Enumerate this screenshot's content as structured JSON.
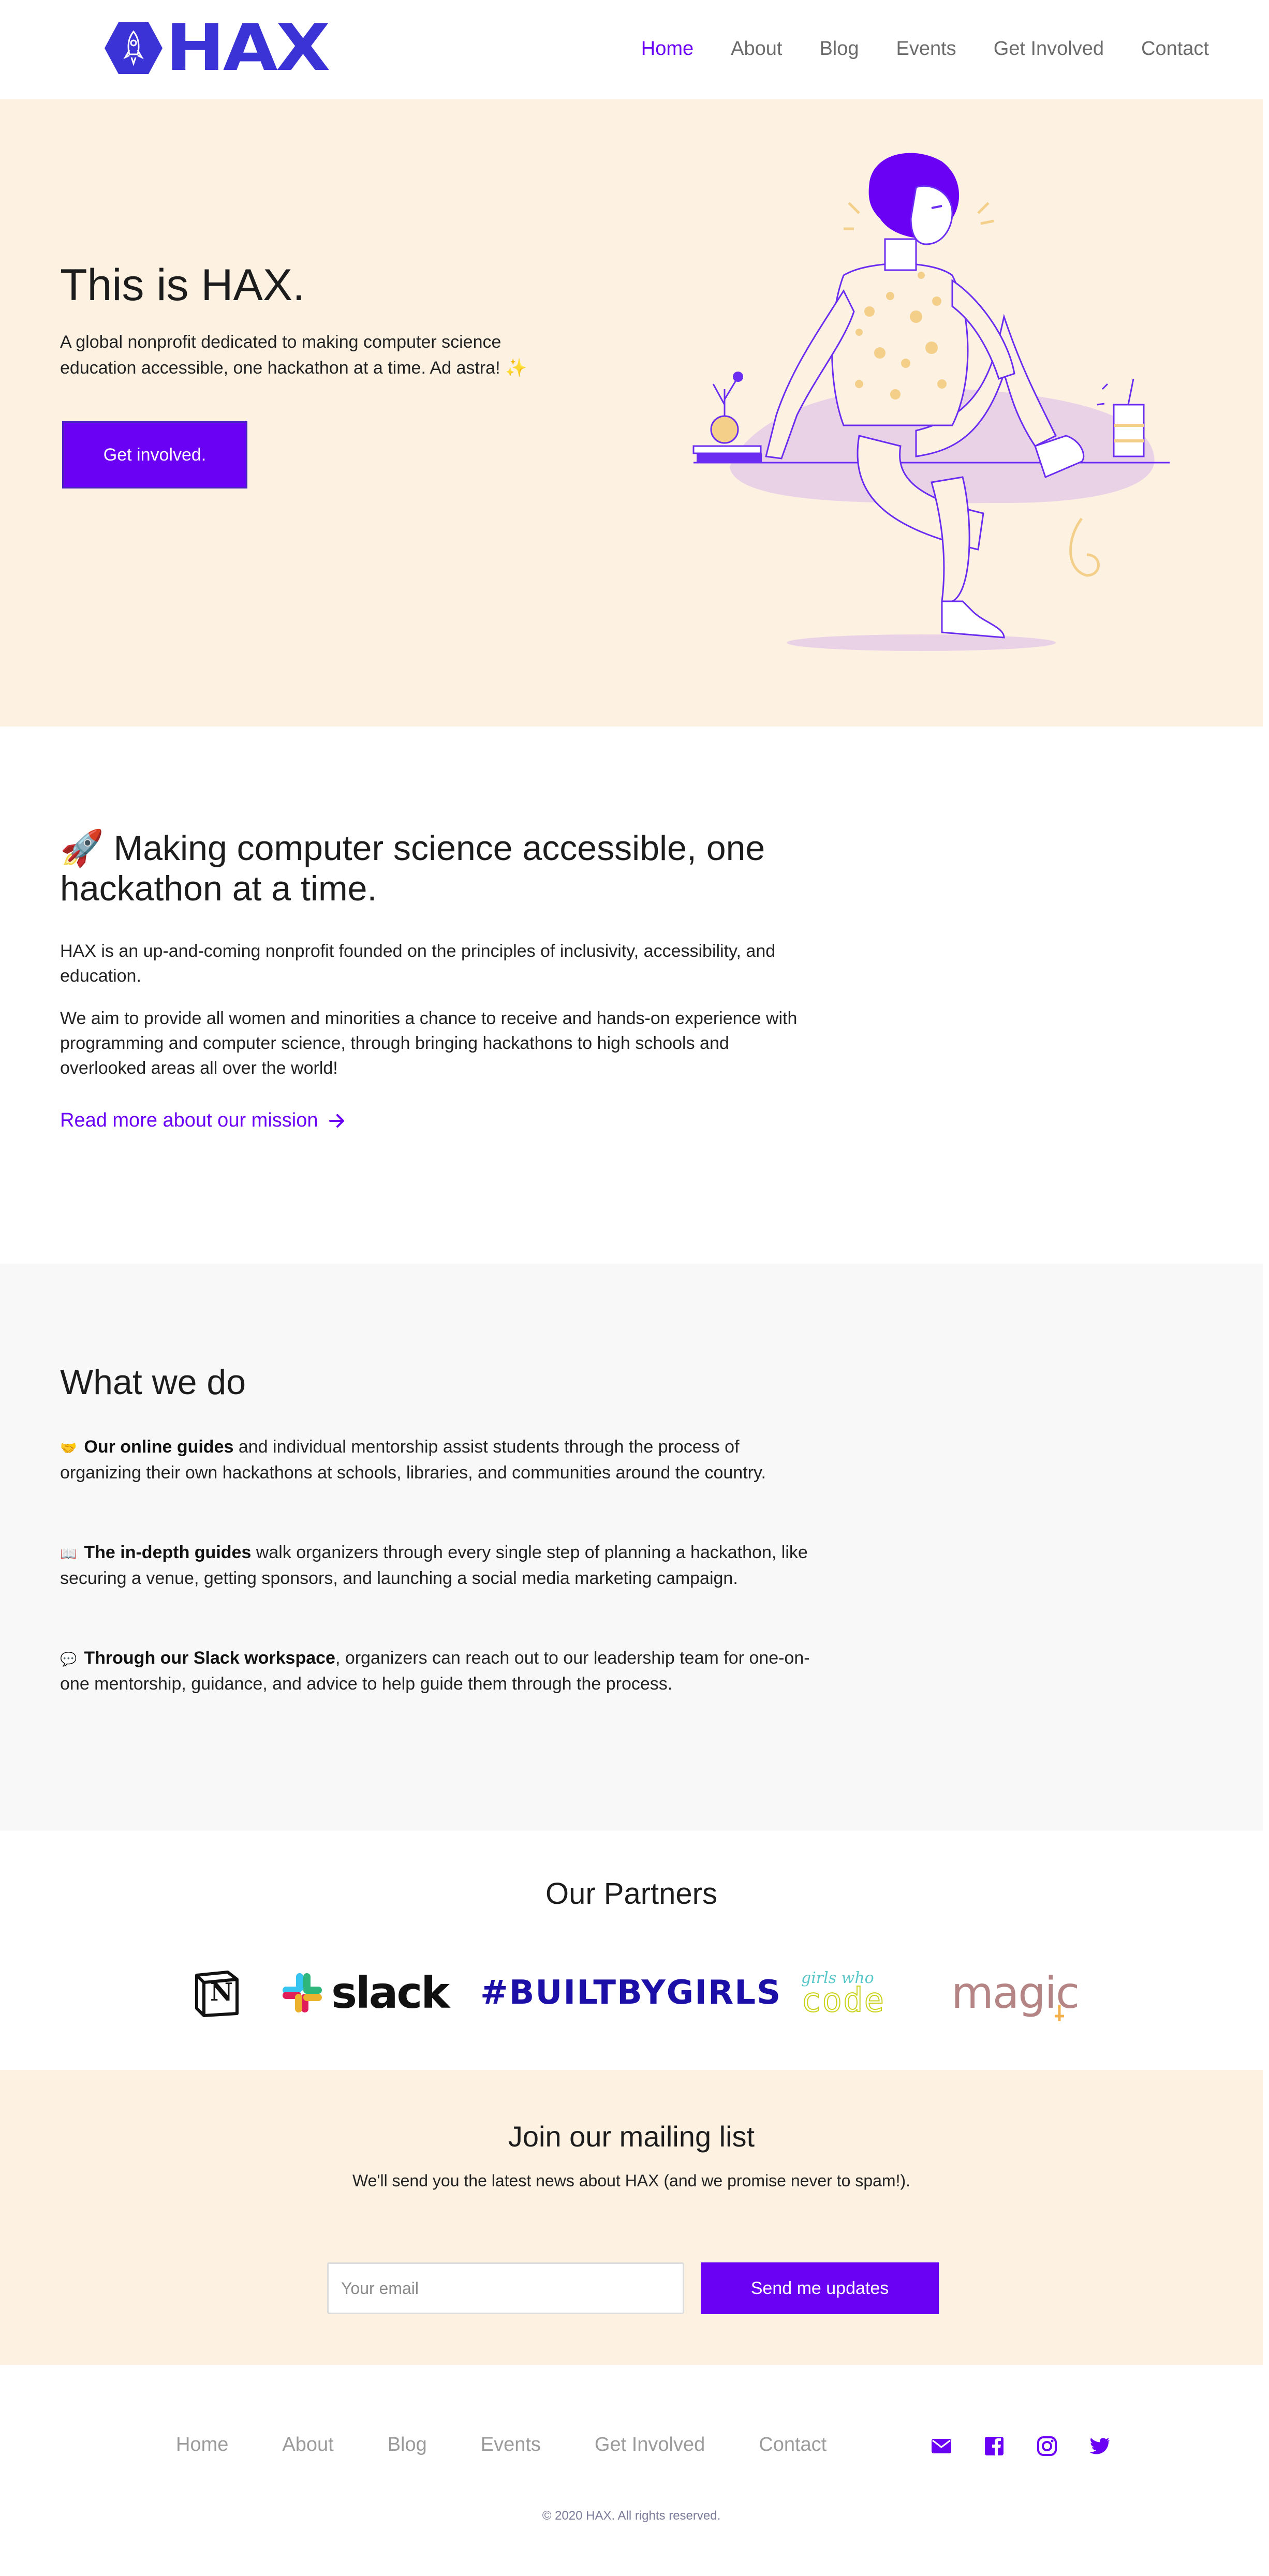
{
  "nav": {
    "logo_text": "HAX",
    "links": [
      "Home",
      "About",
      "Blog",
      "Events",
      "Get Involved",
      "Contact"
    ],
    "active": "Home"
  },
  "hero": {
    "title": "This is HAX.",
    "subtitle": "A global nonprofit dedicated to making computer science education accessible, one hackathon at a time. Ad astra! ✨",
    "button_label": "Get involved."
  },
  "mission": {
    "emoji": "🚀",
    "title": "Making computer science accessible, one hackathon at a time.",
    "p1": "HAX is an up-and-coming nonprofit founded on the principles of inclusivity, accessibility, and education.",
    "p2": "We aim to provide all women and minorities a chance to receive and hands-on experience with programming and computer science, through bringing hackathons to high schools and overlooked areas all over the world!",
    "link_label": "Read more about our mission"
  },
  "what_we_do": {
    "title": "What we do",
    "items": [
      {
        "emoji": "🤝",
        "bold": "Our online guides",
        "text": " and individual mentorship assist students through the process of organizing their own hackathons at schools, libraries, and communities around the country."
      },
      {
        "emoji": "📖",
        "bold": "The in-depth guides",
        "text": " walk organizers through every single step of planning a hackathon, like securing a venue, getting sponsors, and launching a social media marketing campaign."
      },
      {
        "emoji": "💬",
        "bold": "Through our Slack workspace",
        "text": ", organizers can reach out to our leadership team for one-on-one mentorship, guidance, and advice to help guide them through the process."
      }
    ]
  },
  "partners": {
    "title": "Our Partners",
    "logos": {
      "notion": "N",
      "slack": "slack",
      "builtbygirls": "#BUILTBYGIRLS",
      "girlswhocode_top": "girls who",
      "girlswhocode_bottom": "code",
      "magic": "magic"
    }
  },
  "mailing": {
    "title": "Join our mailing list",
    "subtitle": "We'll send you the latest news about HAX (and we promise never to spam!).",
    "placeholder": "Your email",
    "button_label": "Send me updates"
  },
  "footer": {
    "links": [
      "Home",
      "About",
      "Blog",
      "Events",
      "Get Involved",
      "Contact"
    ],
    "icons": [
      "email-icon",
      "facebook-icon",
      "instagram-icon",
      "twitter-icon"
    ],
    "copyright": "© 2020 HAX. All rights reserved."
  },
  "colors": {
    "accent": "#6a00f4",
    "logo": "#3b33d6",
    "cream": "#fdf1e2",
    "light_gray": "#f8f8f8"
  }
}
